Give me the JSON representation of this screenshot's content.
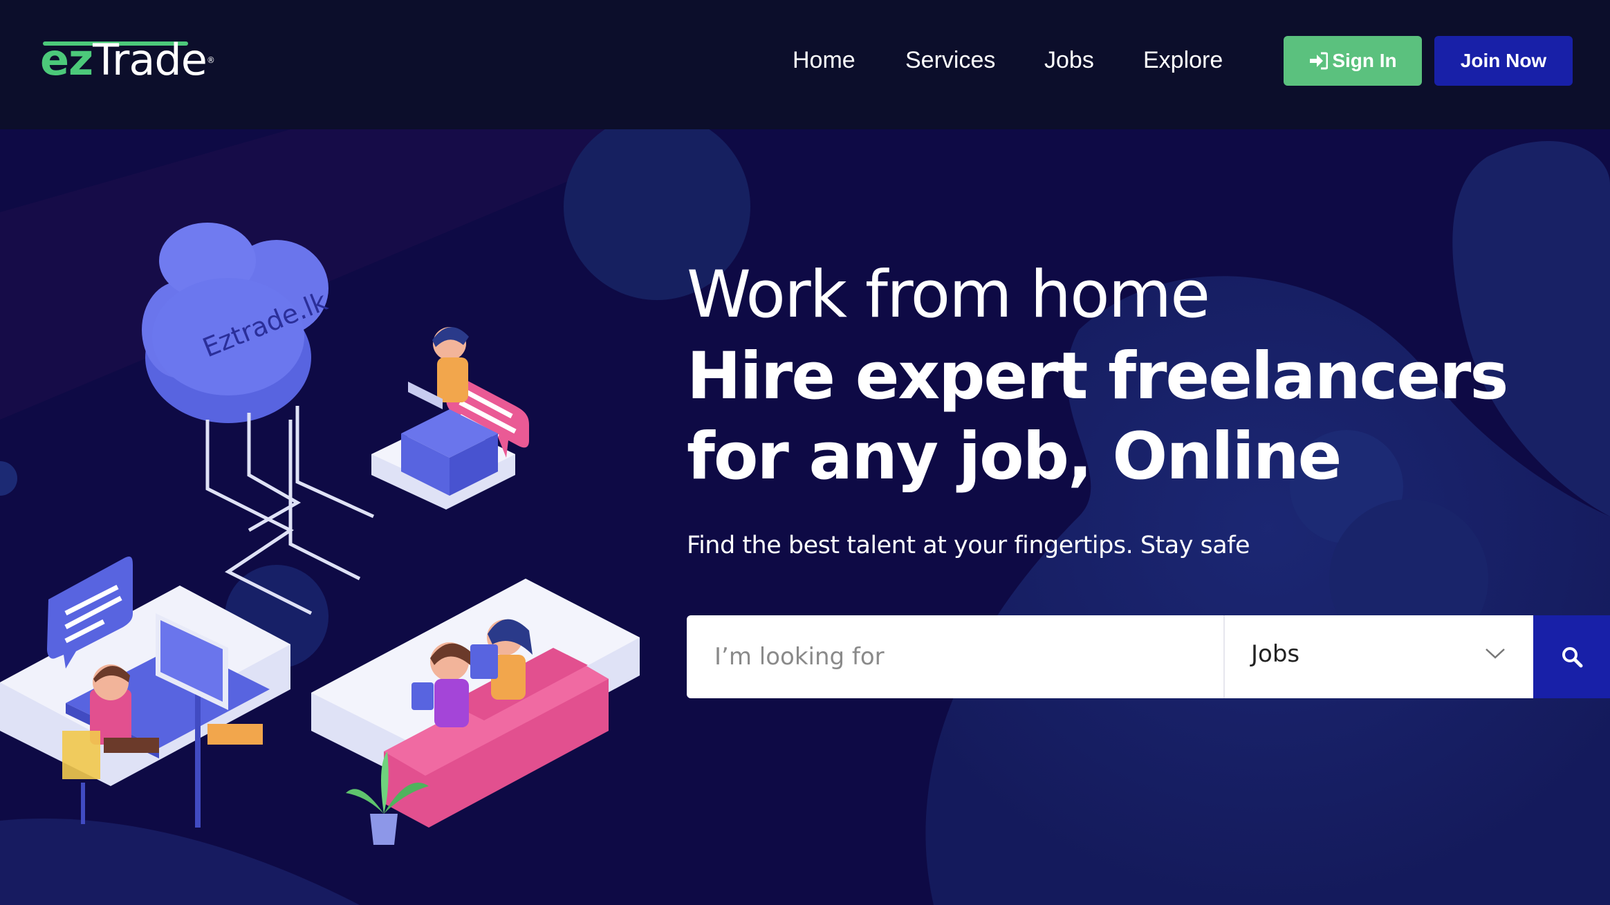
{
  "brand": {
    "logo_ez": "ez",
    "logo_trade": "Trade",
    "logo_reg": "®",
    "green": "#4cc97a"
  },
  "nav": {
    "items": [
      {
        "label": "Home"
      },
      {
        "label": "Services"
      },
      {
        "label": "Jobs"
      },
      {
        "label": "Explore"
      }
    ]
  },
  "auth": {
    "signin_label": "Sign In",
    "signin_icon": "sign-in-icon",
    "join_label": "Join Now",
    "signin_color": "#5bc17e",
    "join_color": "#1820a8"
  },
  "hero": {
    "heading_light": "Work from home",
    "heading_bold": "Hire expert freelancers for any job, Online",
    "subtitle": "Find the best talent at your fingertips. Stay safe",
    "illustration_cloud_text": "Eztrade.lk"
  },
  "search": {
    "placeholder": "I’m looking for",
    "category_selected": "Jobs",
    "search_icon": "search-icon"
  }
}
